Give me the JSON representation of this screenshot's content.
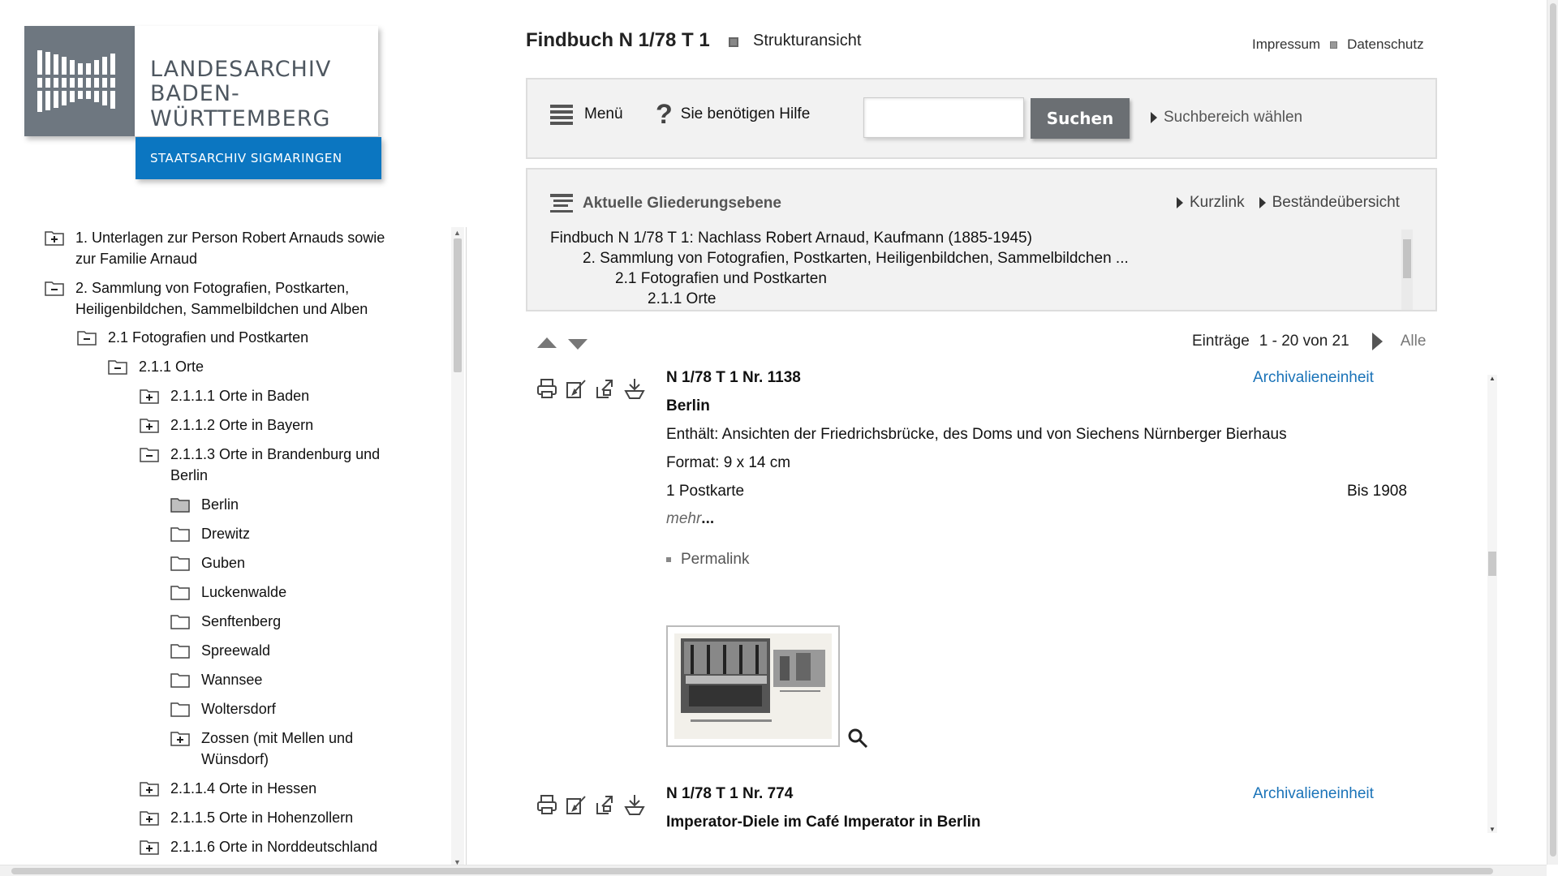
{
  "logo": {
    "line1": "LANDESARCHIV",
    "line2": "BADEN-WÜRTTEMBERG",
    "subunit": "STAATSARCHIV SIGMARINGEN"
  },
  "header": {
    "title": "Findbuch N 1/78 T 1",
    "view": "Strukturansicht",
    "links": [
      "Impressum",
      "Datenschutz"
    ]
  },
  "toolbar": {
    "menu_label": "Menü",
    "help_label": "Sie benötigen Hilfe",
    "search_value": "",
    "search_button": "Suchen",
    "scope_label": "Suchbereich wählen"
  },
  "outline": {
    "heading": "Aktuelle Gliederungsebene",
    "links": [
      "Kurzlink",
      "Beständeübersicht"
    ],
    "path": [
      "Findbuch N 1/78 T 1: Nachlass Robert Arnaud, Kaufmann (1885-1945)",
      "2. Sammlung von Fotografien, Postkarten, Heiligenbildchen, Sammelbildchen ...",
      "2.1 Fotografien und Postkarten",
      "2.1.1 Orte"
    ]
  },
  "tree": {
    "items": [
      {
        "label": "1. Unterlagen zur Person Robert Arnauds sowie zur Familie Arnaud",
        "icon": "folder-plus-icon"
      },
      {
        "label": "2. Sammlung von Fotografien, Postkarten, Heiligenbildchen, Sammelbildchen und Alben",
        "icon": "folder-minus-icon"
      },
      {
        "label": "2.1 Fotografien und Postkarten",
        "icon": "folder-minus-icon"
      },
      {
        "label": "2.1.1 Orte",
        "icon": "folder-minus-icon"
      },
      {
        "label": "2.1.1.1 Orte in Baden",
        "icon": "folder-plus-icon"
      },
      {
        "label": "2.1.1.2 Orte in Bayern",
        "icon": "folder-plus-icon"
      },
      {
        "label": "2.1.1.3 Orte in Brandenburg und Berlin",
        "icon": "folder-minus-icon"
      },
      {
        "label": "Berlin",
        "icon": "folder-selected-icon"
      },
      {
        "label": "Drewitz",
        "icon": "folder-icon"
      },
      {
        "label": "Guben",
        "icon": "folder-icon"
      },
      {
        "label": "Luckenwalde",
        "icon": "folder-icon"
      },
      {
        "label": "Senftenberg",
        "icon": "folder-icon"
      },
      {
        "label": "Spreewald",
        "icon": "folder-icon"
      },
      {
        "label": "Wannsee",
        "icon": "folder-icon"
      },
      {
        "label": "Woltersdorf",
        "icon": "folder-icon"
      },
      {
        "label": "Zossen (mit Mellen und Wünsdorf)",
        "icon": "folder-plus-icon"
      },
      {
        "label": "2.1.1.4 Orte in Hessen",
        "icon": "folder-plus-icon"
      },
      {
        "label": "2.1.1.5 Orte in Hohenzollern",
        "icon": "folder-plus-icon"
      },
      {
        "label": "2.1.1.6 Orte in Norddeutschland",
        "icon": "folder-plus-icon"
      }
    ]
  },
  "pager": {
    "label": "Einträge",
    "range": "1 - 20 von 21",
    "all_label": "Alle"
  },
  "entries": [
    {
      "signature": "N 1/78 T 1 Nr. 1138",
      "type": "Archivalieneinheit",
      "title": "Berlin",
      "contains": "Enthält: Ansichten der Friedrichsbrücke, des Doms und von Siechens Nürnberger Bierhaus",
      "format": "Format: 9 x 14 cm",
      "amount": "1 Postkarte",
      "date": "Bis 1908",
      "more": "mehr",
      "more_dots": "...",
      "permalink": "Permalink"
    },
    {
      "signature": "N 1/78 T 1 Nr. 774",
      "type": "Archivalieneinheit",
      "title": "Imperator-Diele im Café Imperator in Berlin"
    }
  ],
  "icons": {
    "tools": [
      "print-icon",
      "edit-icon",
      "export-icon",
      "download-icon"
    ],
    "zoom": "magnifier-icon"
  },
  "colors": {
    "brand_blue": "#0b76c1",
    "logo_gray": "#6e7780",
    "link_blue": "#1a73b8",
    "button_gray": "#6b6f73"
  }
}
